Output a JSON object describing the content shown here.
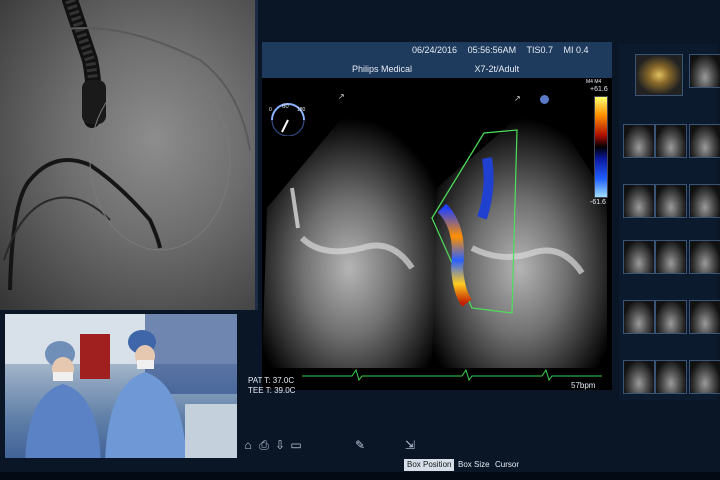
{
  "header": {
    "date": "06/24/2016",
    "time": "05:56:56AM",
    "tis": "TIS0.7",
    "mi": "MI 0.4",
    "vendor": "Philips Medical",
    "probe": "X7-2t/Adult"
  },
  "probe_angle": {
    "value": "60",
    "min": "0",
    "max": "180"
  },
  "color_scale": {
    "unit": "M4 M4",
    "top": "+61.6",
    "bottom": "-61.6"
  },
  "vitals": {
    "pat_temp": "PAT T: 37.0C",
    "tee_temp": "TEE T: 39.0C",
    "heart_rate": "57bpm"
  },
  "status_bar": {
    "box_position": "Box Position",
    "box_size": "Box Size",
    "cursor": "Cursor"
  },
  "colors": {
    "background": "#0a1526",
    "header": "#1e3a5c",
    "ecg_trace": "#39d34a",
    "color_box_outline": "#4ce05a"
  },
  "icons": [
    "capture-icon",
    "print-icon",
    "save-icon",
    "review-icon",
    "annotate-icon",
    "measure-icon"
  ]
}
